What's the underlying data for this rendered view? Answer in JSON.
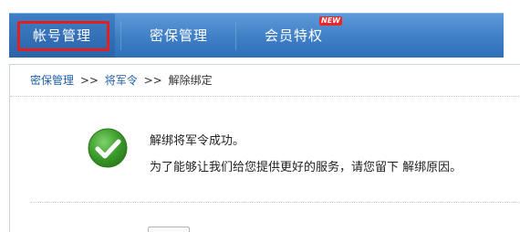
{
  "nav": {
    "tabs": [
      {
        "label": "帐号管理"
      },
      {
        "label": "密保管理"
      },
      {
        "label": "会员特权"
      }
    ],
    "new_badge": "NEW",
    "bar_color": "#3f7fc6",
    "highlight_color": "#e02020"
  },
  "breadcrumb": {
    "items": [
      {
        "label": "密保管理"
      },
      {
        "label": "将军令"
      },
      {
        "label": "解除绑定"
      }
    ],
    "separator": ">>"
  },
  "message": {
    "icon": "checkmark-circle-icon",
    "icon_color": "#3a9a2a",
    "title": "解绑将军令成功。",
    "detail": "为了能够让我们给您提供更好的服务，请您留下 解绑原因。"
  }
}
